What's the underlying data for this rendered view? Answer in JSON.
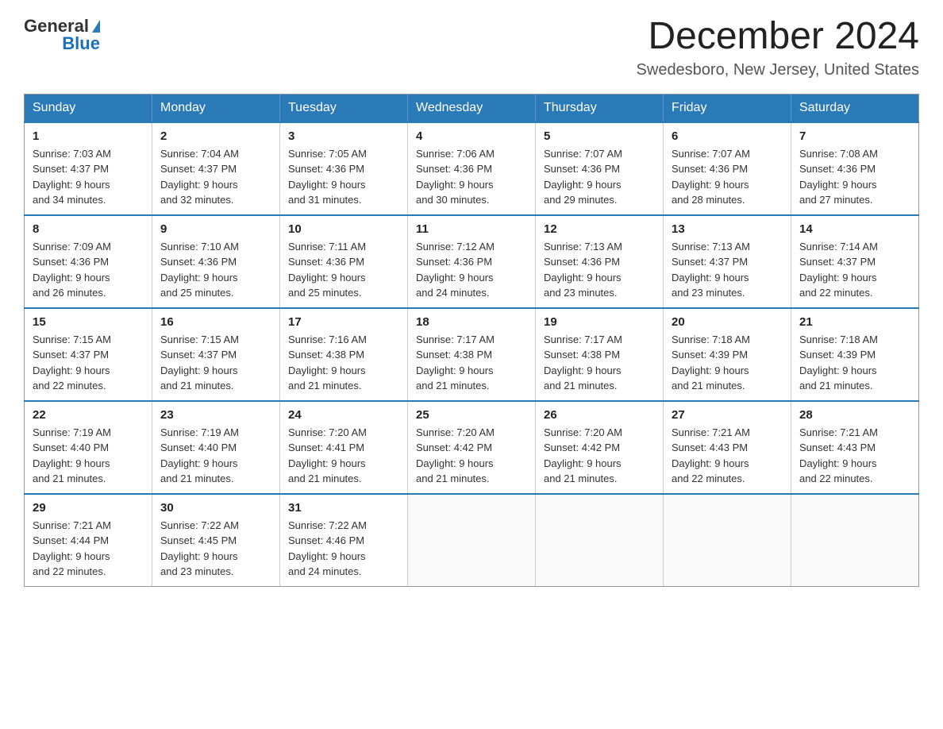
{
  "logo": {
    "general": "General",
    "blue": "Blue"
  },
  "title": "December 2024",
  "location": "Swedesboro, New Jersey, United States",
  "weekdays": [
    "Sunday",
    "Monday",
    "Tuesday",
    "Wednesday",
    "Thursday",
    "Friday",
    "Saturday"
  ],
  "weeks": [
    [
      {
        "day": "1",
        "sunrise": "7:03 AM",
        "sunset": "4:37 PM",
        "daylight": "9 hours and 34 minutes."
      },
      {
        "day": "2",
        "sunrise": "7:04 AM",
        "sunset": "4:37 PM",
        "daylight": "9 hours and 32 minutes."
      },
      {
        "day": "3",
        "sunrise": "7:05 AM",
        "sunset": "4:36 PM",
        "daylight": "9 hours and 31 minutes."
      },
      {
        "day": "4",
        "sunrise": "7:06 AM",
        "sunset": "4:36 PM",
        "daylight": "9 hours and 30 minutes."
      },
      {
        "day": "5",
        "sunrise": "7:07 AM",
        "sunset": "4:36 PM",
        "daylight": "9 hours and 29 minutes."
      },
      {
        "day": "6",
        "sunrise": "7:07 AM",
        "sunset": "4:36 PM",
        "daylight": "9 hours and 28 minutes."
      },
      {
        "day": "7",
        "sunrise": "7:08 AM",
        "sunset": "4:36 PM",
        "daylight": "9 hours and 27 minutes."
      }
    ],
    [
      {
        "day": "8",
        "sunrise": "7:09 AM",
        "sunset": "4:36 PM",
        "daylight": "9 hours and 26 minutes."
      },
      {
        "day": "9",
        "sunrise": "7:10 AM",
        "sunset": "4:36 PM",
        "daylight": "9 hours and 25 minutes."
      },
      {
        "day": "10",
        "sunrise": "7:11 AM",
        "sunset": "4:36 PM",
        "daylight": "9 hours and 25 minutes."
      },
      {
        "day": "11",
        "sunrise": "7:12 AM",
        "sunset": "4:36 PM",
        "daylight": "9 hours and 24 minutes."
      },
      {
        "day": "12",
        "sunrise": "7:13 AM",
        "sunset": "4:36 PM",
        "daylight": "9 hours and 23 minutes."
      },
      {
        "day": "13",
        "sunrise": "7:13 AM",
        "sunset": "4:37 PM",
        "daylight": "9 hours and 23 minutes."
      },
      {
        "day": "14",
        "sunrise": "7:14 AM",
        "sunset": "4:37 PM",
        "daylight": "9 hours and 22 minutes."
      }
    ],
    [
      {
        "day": "15",
        "sunrise": "7:15 AM",
        "sunset": "4:37 PM",
        "daylight": "9 hours and 22 minutes."
      },
      {
        "day": "16",
        "sunrise": "7:15 AM",
        "sunset": "4:37 PM",
        "daylight": "9 hours and 21 minutes."
      },
      {
        "day": "17",
        "sunrise": "7:16 AM",
        "sunset": "4:38 PM",
        "daylight": "9 hours and 21 minutes."
      },
      {
        "day": "18",
        "sunrise": "7:17 AM",
        "sunset": "4:38 PM",
        "daylight": "9 hours and 21 minutes."
      },
      {
        "day": "19",
        "sunrise": "7:17 AM",
        "sunset": "4:38 PM",
        "daylight": "9 hours and 21 minutes."
      },
      {
        "day": "20",
        "sunrise": "7:18 AM",
        "sunset": "4:39 PM",
        "daylight": "9 hours and 21 minutes."
      },
      {
        "day": "21",
        "sunrise": "7:18 AM",
        "sunset": "4:39 PM",
        "daylight": "9 hours and 21 minutes."
      }
    ],
    [
      {
        "day": "22",
        "sunrise": "7:19 AM",
        "sunset": "4:40 PM",
        "daylight": "9 hours and 21 minutes."
      },
      {
        "day": "23",
        "sunrise": "7:19 AM",
        "sunset": "4:40 PM",
        "daylight": "9 hours and 21 minutes."
      },
      {
        "day": "24",
        "sunrise": "7:20 AM",
        "sunset": "4:41 PM",
        "daylight": "9 hours and 21 minutes."
      },
      {
        "day": "25",
        "sunrise": "7:20 AM",
        "sunset": "4:42 PM",
        "daylight": "9 hours and 21 minutes."
      },
      {
        "day": "26",
        "sunrise": "7:20 AM",
        "sunset": "4:42 PM",
        "daylight": "9 hours and 21 minutes."
      },
      {
        "day": "27",
        "sunrise": "7:21 AM",
        "sunset": "4:43 PM",
        "daylight": "9 hours and 22 minutes."
      },
      {
        "day": "28",
        "sunrise": "7:21 AM",
        "sunset": "4:43 PM",
        "daylight": "9 hours and 22 minutes."
      }
    ],
    [
      {
        "day": "29",
        "sunrise": "7:21 AM",
        "sunset": "4:44 PM",
        "daylight": "9 hours and 22 minutes."
      },
      {
        "day": "30",
        "sunrise": "7:22 AM",
        "sunset": "4:45 PM",
        "daylight": "9 hours and 23 minutes."
      },
      {
        "day": "31",
        "sunrise": "7:22 AM",
        "sunset": "4:46 PM",
        "daylight": "9 hours and 24 minutes."
      },
      null,
      null,
      null,
      null
    ]
  ],
  "labels": {
    "sunrise": "Sunrise:",
    "sunset": "Sunset:",
    "daylight": "Daylight:"
  }
}
